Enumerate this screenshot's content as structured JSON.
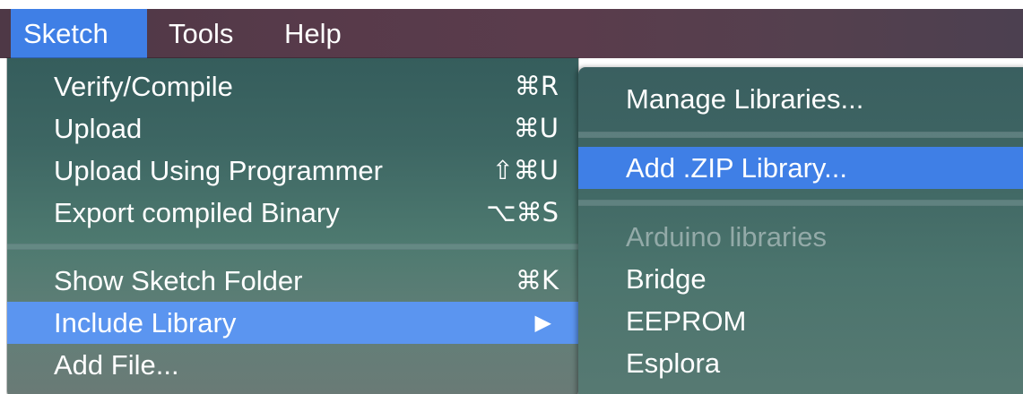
{
  "menubar": {
    "items": [
      {
        "label": "Sketch",
        "active": true
      },
      {
        "label": "Tools",
        "active": false
      },
      {
        "label": "Help",
        "active": false
      }
    ]
  },
  "sketch_menu": {
    "items": [
      {
        "label": "Verify/Compile",
        "shortcut": "⌘R"
      },
      {
        "label": "Upload",
        "shortcut": "⌘U"
      },
      {
        "label": "Upload Using Programmer",
        "shortcut": "⇧⌘U"
      },
      {
        "label": "Export compiled Binary",
        "shortcut": "⌥⌘S"
      },
      {
        "label": "Show Sketch Folder",
        "shortcut": "⌘K"
      },
      {
        "label": "Include Library",
        "shortcut": "▶"
      },
      {
        "label": "Add File...",
        "shortcut": ""
      }
    ]
  },
  "include_library_submenu": {
    "manage": "Manage Libraries...",
    "add_zip": "Add .ZIP Library...",
    "section_header": "Arduino libraries",
    "libraries": [
      "Bridge",
      "EEPROM",
      "Esplora"
    ]
  },
  "colors": {
    "highlight": "#3f7fe6",
    "menu_bg": "#3d6663",
    "menubar_bg": "#573a4a"
  }
}
